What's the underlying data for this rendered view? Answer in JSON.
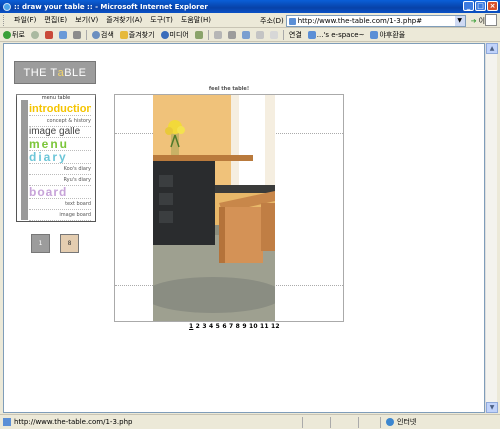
{
  "window": {
    "title": ":: draw your table :: - Microsoft Internet Explorer"
  },
  "menu": [
    "파일(F)",
    "편집(E)",
    "보기(V)",
    "즐겨찾기(A)",
    "도구(T)",
    "도움말(H)"
  ],
  "address": {
    "label": "주소(D)",
    "url": "http://www.the-table.com/1-3.php#",
    "go_label": "이동"
  },
  "toolbar": {
    "back": "뒤로",
    "search": "검색",
    "favorites": "즐겨찾기",
    "media": "미디어",
    "links_label": "연결",
    "link1": "...'s e-space~",
    "link2": "야후환율"
  },
  "site": {
    "logo_pre": "THE T",
    "logo_a": "a",
    "logo_post": "BLE",
    "menu_header": "menu table",
    "items": {
      "introduction": "introduction",
      "concept": "concept & history",
      "gallery": "image galle",
      "menu": "menu",
      "diary": "diary",
      "koo": "Koo's diary",
      "ryu": "Ryu's diary",
      "board": "board",
      "textboard": "text board",
      "imageboard": "image board"
    },
    "boxes": [
      "1",
      "8"
    ],
    "frame_title": "feel the table!",
    "pages_current": "1",
    "pages_rest": "2 3 4 5 6 7 8 9 10 11 12"
  },
  "status": {
    "url": "http://www.the-table.com/1-3.php",
    "zone": "인터넷"
  },
  "colors": {
    "intro": "#f5c400",
    "gallery": "#444444",
    "menu": "#7cc63a",
    "diary": "#6cc6d8",
    "board": "#c7a3d9"
  }
}
